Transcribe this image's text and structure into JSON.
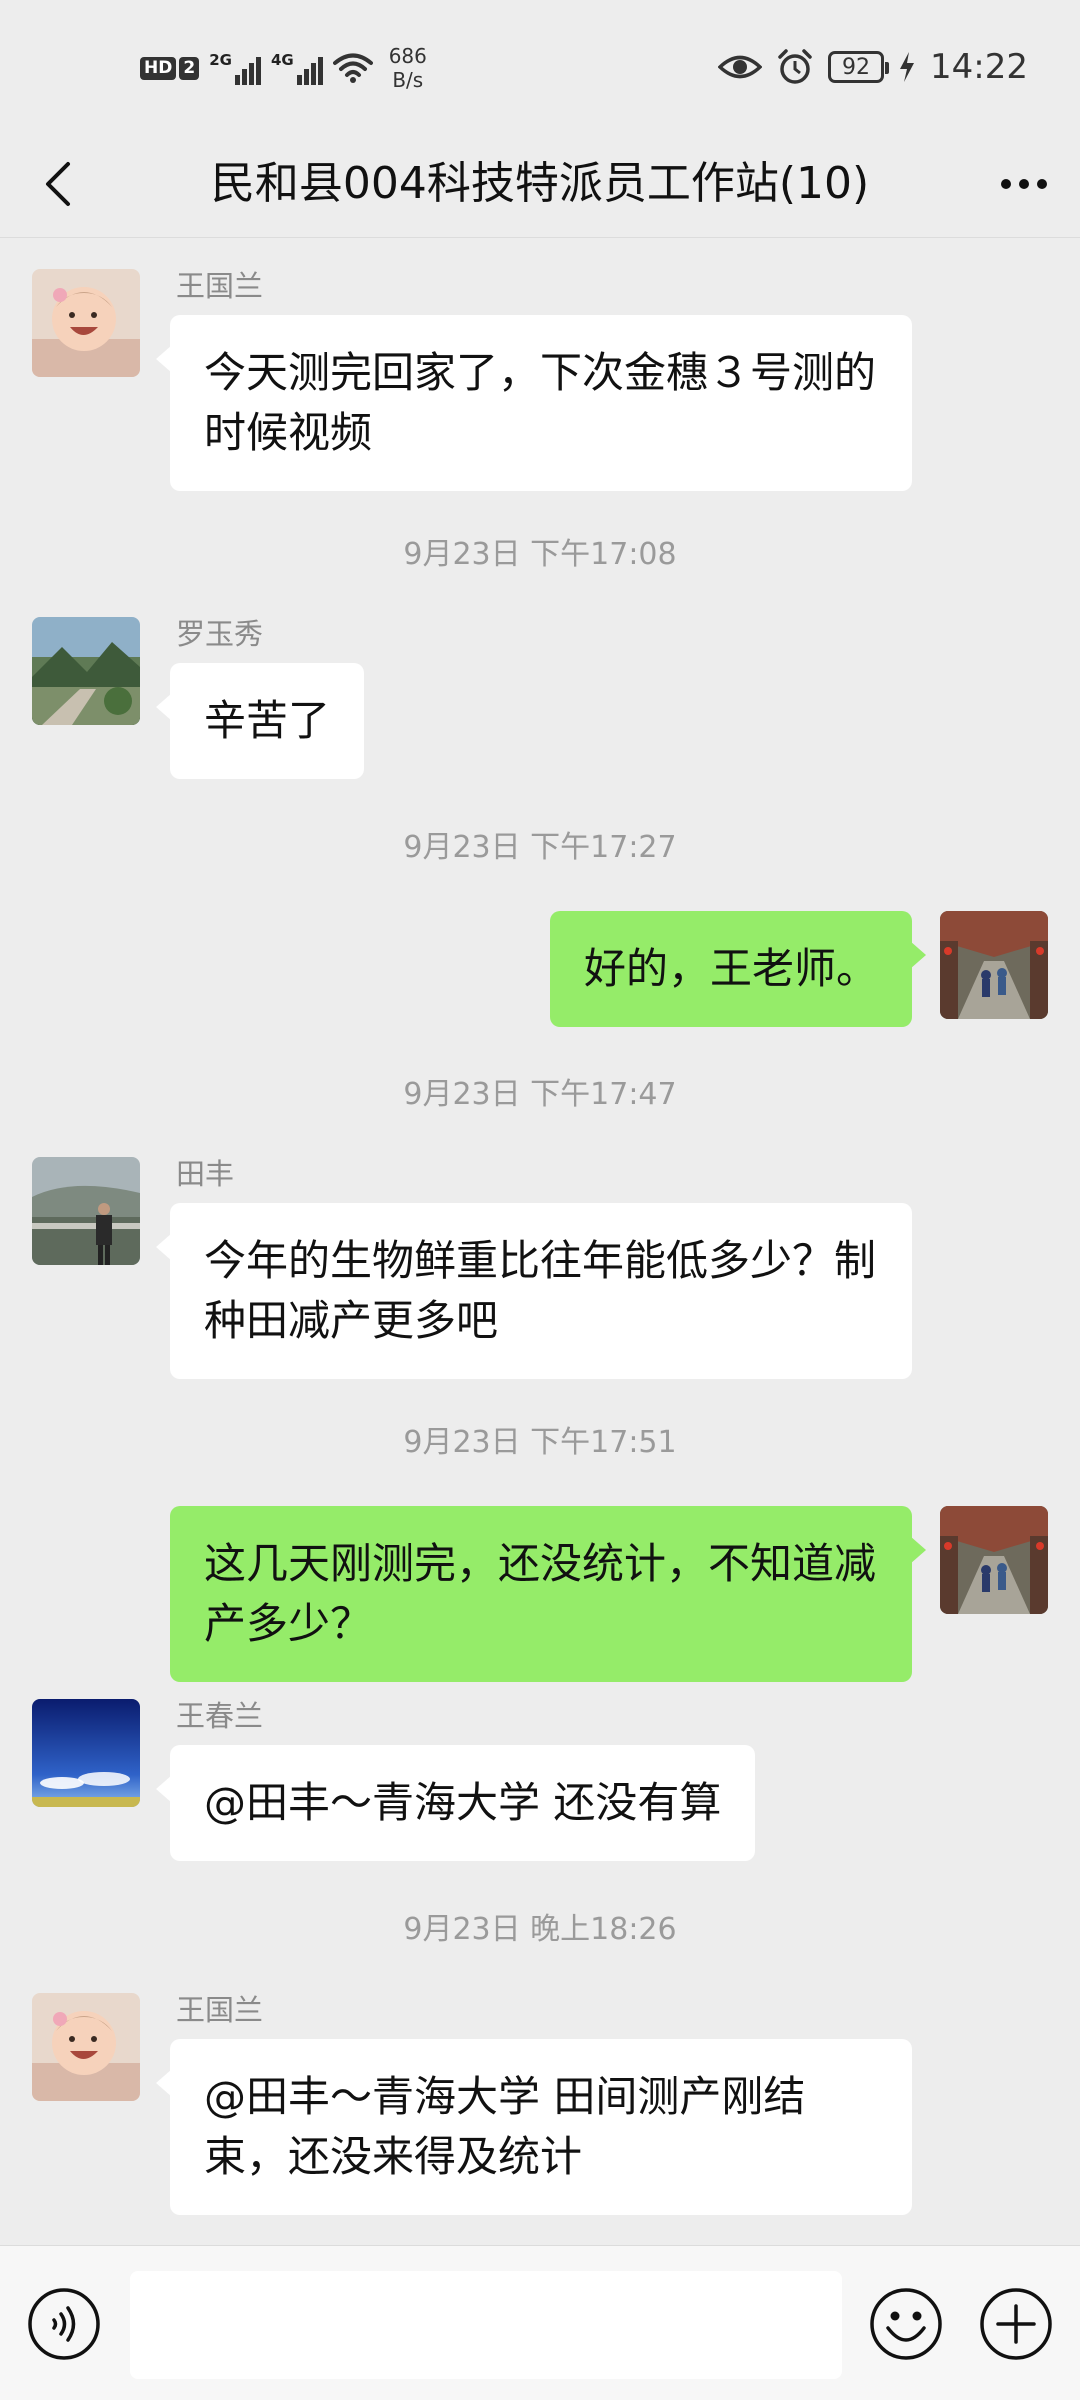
{
  "status_bar": {
    "hd_label": "HD",
    "sim_label": "2",
    "signal_1_gen": "2G",
    "signal_2_gen": "4G",
    "speed_value": "686",
    "speed_unit": "B/s",
    "battery": "92",
    "time": "14:22"
  },
  "header": {
    "title": "民和县004科技特派员工作站(10)"
  },
  "messages": [
    {
      "sender": "王国兰",
      "text": "今天测完回家了，下次金穗３号测的时候视频"
    },
    {
      "time": "9月23日 下午17:08"
    },
    {
      "sender": "罗玉秀",
      "text": "辛苦了"
    },
    {
      "time": "9月23日 下午17:27"
    },
    {
      "text": "好的，王老师。"
    },
    {
      "time": "9月23日 下午17:47"
    },
    {
      "sender": "田丰",
      "text": "今年的生物鲜重比往年能低多少？制种田减产更多吧"
    },
    {
      "time": "9月23日 下午17:51"
    },
    {
      "text": "这几天刚测完，还没统计，不知道减产多少？"
    },
    {
      "sender": "王春兰",
      "text": "@田丰～青海大学  还没有算"
    },
    {
      "time": "9月23日 晚上18:26"
    },
    {
      "sender": "王国兰",
      "text": "@田丰～青海大学  田间测产刚结束，还没来得及统计"
    }
  ],
  "colors": {
    "background": "#ededed",
    "own_bubble": "#95ec69",
    "other_bubble": "#ffffff"
  },
  "input": {
    "placeholder": ""
  }
}
